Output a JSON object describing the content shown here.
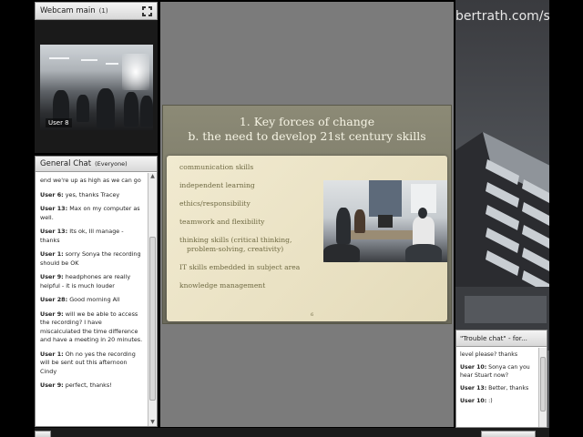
{
  "webcam": {
    "title": "Webcam main",
    "count": "(1)",
    "user_label": "User 8"
  },
  "general_chat": {
    "title": "General Chat",
    "scope": "(Everyone)",
    "messages": [
      {
        "user": "",
        "text": "end we're up as high as we can go"
      },
      {
        "user": "User 6:",
        "text": "yes, thanks Tracey"
      },
      {
        "user": "User 13:",
        "text": "Max on my computer as well."
      },
      {
        "user": "User 13:",
        "text": "Its ok, Ill manage - thanks"
      },
      {
        "user": "User 1:",
        "text": "sorry Sonya the recording should be OK"
      },
      {
        "user": "User 9:",
        "text": "headphones are  really helpful - it is much louder"
      },
      {
        "user": "User 28:",
        "text": "Good morning All"
      },
      {
        "user": "User 9:",
        "text": "will we be able to access the recording? I have miscalculated the time difference and have a meeting in 20 minutes."
      },
      {
        "user": "User 1:",
        "text": "Oh no yes the recording will be sent out this afternoon Cindy"
      },
      {
        "user": "User 9:",
        "text": "perfect, thanks!"
      }
    ]
  },
  "slide": {
    "title_line1": "1. Key forces of change",
    "title_line2": "b. the need to develop 21st century skills",
    "bullets": [
      {
        "text": "communication skills",
        "cont": ""
      },
      {
        "text": "independent learning",
        "cont": ""
      },
      {
        "text": "ethics/responsibility",
        "cont": ""
      },
      {
        "text": "teamwork and flexibility",
        "cont": ""
      },
      {
        "text": "thinking skills (critical thinking,",
        "cont": "problem-solving, creativity)"
      },
      {
        "text": "IT skills embedded in subject area",
        "cont": ""
      },
      {
        "text": "knowledge management",
        "cont": ""
      }
    ],
    "page_number": "6"
  },
  "background": {
    "url_text": "bertrath.com/ser"
  },
  "trouble_chat": {
    "title": "\"Trouble chat\" - for...",
    "messages": [
      {
        "user": "",
        "text": "level please? thanks"
      },
      {
        "user": "User 10:",
        "text": "Sonya can you hear Stuart now?"
      },
      {
        "user": "User 13:",
        "text": "Better, thanks"
      },
      {
        "user": "User 10:",
        "text": ":)"
      }
    ]
  },
  "colors": {
    "slide_text": "#6f6a43",
    "slide_title": "#f5f3e3",
    "stage_bg": "#7b7b7b"
  }
}
